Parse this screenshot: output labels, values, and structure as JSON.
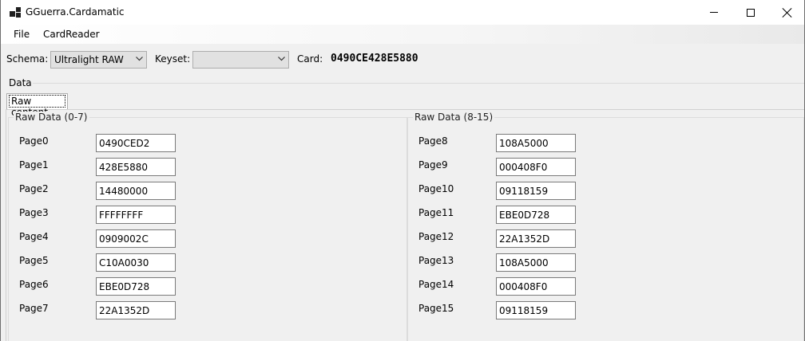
{
  "window": {
    "title": "GGuerra.Cardamatic",
    "controls": {
      "minimize_icon": "minimize-icon",
      "maximize_icon": "maximize-icon",
      "close_icon": "close-icon"
    }
  },
  "menu": {
    "items": [
      "File",
      "CardReader"
    ]
  },
  "toolbar": {
    "schema_label": "Schema:",
    "schema_value": "Ultralight RAW",
    "keyset_label": "Keyset:",
    "keyset_value": "",
    "card_label": "Card:",
    "card_value": "0490CE428E5880"
  },
  "data_group": {
    "label": "Data",
    "tabs": [
      "Raw content"
    ]
  },
  "raw_left": {
    "title": "Raw Data (0-7)",
    "pages": [
      {
        "label": "Page0",
        "value": "0490CED2"
      },
      {
        "label": "Page1",
        "value": "428E5880"
      },
      {
        "label": "Page2",
        "value": "14480000"
      },
      {
        "label": "Page3",
        "value": "FFFFFFFF"
      },
      {
        "label": "Page4",
        "value": "0909002C"
      },
      {
        "label": "Page5",
        "value": "C10A0030"
      },
      {
        "label": "Page6",
        "value": "EBE0D728"
      },
      {
        "label": "Page7",
        "value": "22A1352D"
      }
    ]
  },
  "raw_right": {
    "title": "Raw Data (8-15)",
    "pages": [
      {
        "label": "Page8",
        "value": "108A5000"
      },
      {
        "label": "Page9",
        "value": "000408F0"
      },
      {
        "label": "Page10",
        "value": "09118159"
      },
      {
        "label": "Page11",
        "value": "EBE0D728"
      },
      {
        "label": "Page12",
        "value": "22A1352D"
      },
      {
        "label": "Page13",
        "value": "108A5000"
      },
      {
        "label": "Page14",
        "value": "000408F0"
      },
      {
        "label": "Page15",
        "value": "09118159"
      }
    ]
  }
}
